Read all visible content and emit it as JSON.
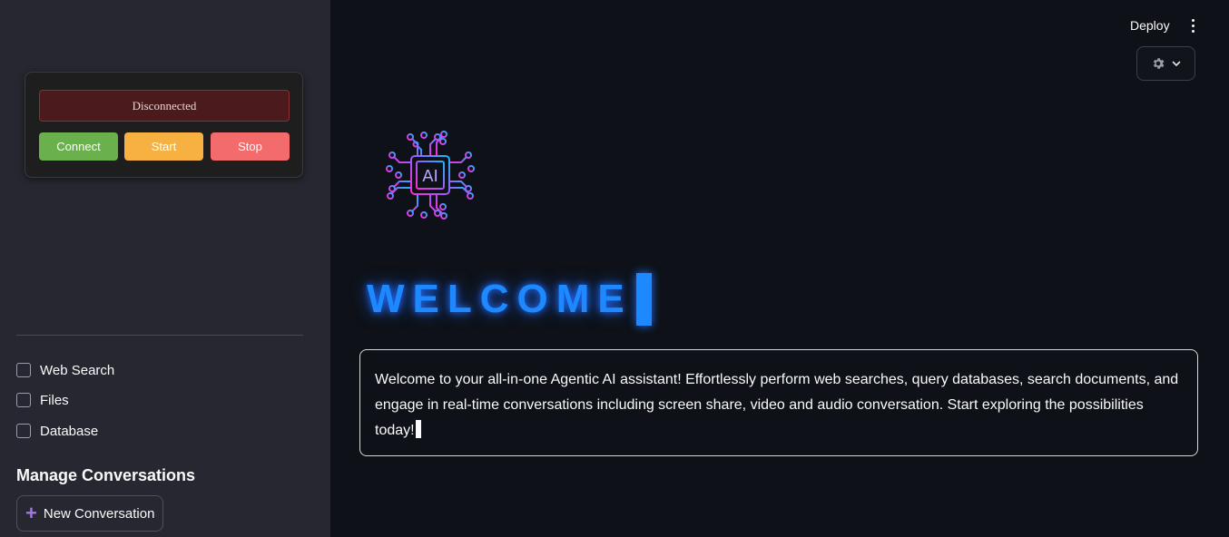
{
  "connection": {
    "status": "Disconnected",
    "connect_label": "Connect",
    "start_label": "Start",
    "stop_label": "Stop",
    "colors": {
      "connect": "#6ab04c",
      "start": "#f7b140",
      "stop": "#f36b6b",
      "status_bg": "#4a1a1c"
    }
  },
  "sidebar": {
    "options": [
      {
        "label": "Web Search",
        "checked": false
      },
      {
        "label": "Files",
        "checked": false
      },
      {
        "label": "Database",
        "checked": false
      }
    ],
    "section_title": "Manage Conversations",
    "new_conversation_label": "New Conversation",
    "new_conversation_icon": "plus-icon"
  },
  "header": {
    "deploy_label": "Deploy",
    "menu_icon": "kebab-menu-icon",
    "settings_icon": "gear-icon",
    "settings_chevron": "chevron-down-icon"
  },
  "main": {
    "logo_text": "AI",
    "welcome": "WELCOME",
    "intro_text": "Welcome to your all-in-one Agentic AI assistant! Effortlessly perform web searches, query databases, search documents, and engage in real-time conversations including screen share, video and audio conversation. Start exploring the possibilities today!",
    "accent_color": "#1e88ff"
  }
}
